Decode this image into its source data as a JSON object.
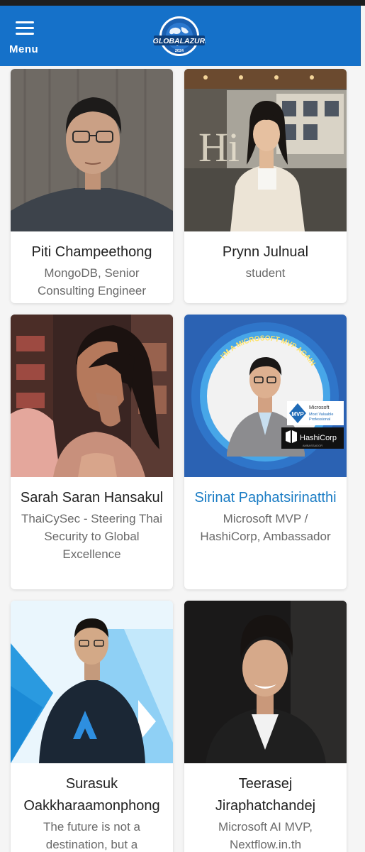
{
  "header": {
    "menu_label": "Menu",
    "logo_text": "#GLOBALAZURE",
    "logo_year": "2024",
    "brand_color": "#1571c9"
  },
  "speakers": [
    {
      "name": "Piti Champeethong",
      "role": "MongoDB, Senior Consulting Engineer"
    },
    {
      "name": "Prynn Julnual",
      "role": "student"
    },
    {
      "name": "Sarah Saran Hansakul",
      "role": "ThaiCySec - Steering Thai Security to Global Excellence"
    },
    {
      "name": "Sirinat Paphatsirinatthi",
      "role": "Microsoft MVP / HashiCorp, Ambassador",
      "badge_mvp": "MVP",
      "badge_ms": "Microsoft",
      "badge_mvp_line1": "Most Valuable",
      "badge_mvp_line2": "Professional",
      "badge_hashi": "HashiCorp",
      "badge_hashi_sub": "AMBASSADOR",
      "frame_text": "I'M A MICROSOFT MVP AGAIN"
    },
    {
      "name": "Surasuk Oakkharaamonphong",
      "role": "The future is not a destination, but a"
    },
    {
      "name": "Teerasej Jiraphatchandej",
      "role": "Microsoft AI MVP, Nextflow.in.th"
    }
  ]
}
